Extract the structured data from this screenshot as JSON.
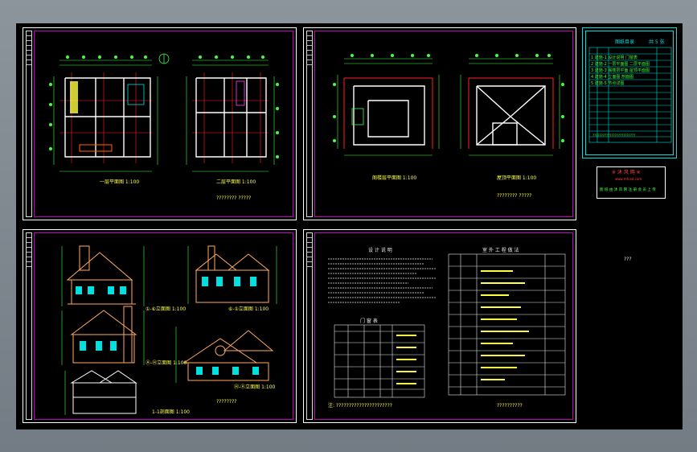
{
  "colors": {
    "background": "#000000",
    "frame_outer": "#ffffff",
    "frame_inner": "#c000c0",
    "dimension": "#40ff40",
    "wall": "#ffffff",
    "axis": "#ff2020",
    "title_text": "#ffff40",
    "index_table": "#00e0e0"
  },
  "sheets": {
    "plans_1": {
      "plan_a_title": "一层平面图 1:100",
      "plan_b_title": "二层平面图 1:100",
      "note": "???????? ?????"
    },
    "plans_2": {
      "plan_a_title": "阁楼层平面图 1:100",
      "plan_b_title": "屋顶平面图 1:100",
      "note": "???????? ?????"
    },
    "elevations": {
      "elev_a_title": "①-⑥立面图 1:100",
      "elev_b_title": "⑥-①立面图 1:100",
      "elev_c_title": "Ⓐ-Ⓗ立面图 1:100",
      "elev_d_title": "Ⓗ-Ⓐ立面图 1:100",
      "section_title": "1-1剖面图 1:100",
      "note": "????????"
    },
    "notes": {
      "heading_left": "设 计 说 明",
      "heading_right": "室 外 工 程 做 法",
      "door_table_title": "门 窗 表",
      "footer_note": "注: ??????????????????????",
      "sign": "??????????"
    }
  },
  "index_panel": {
    "title": "图纸目录",
    "subtitle": "共 5 张",
    "columns": [
      "序号",
      "图 号",
      "图 纸 名 称",
      "备注"
    ],
    "rows": [
      [
        "1",
        "建施-1",
        "设计说明 门窗表",
        ""
      ],
      [
        "2",
        "建施-2",
        "一层平面图 二层平面图",
        ""
      ],
      [
        "3",
        "建施-3",
        "阁楼层平面 屋顶平面图",
        ""
      ],
      [
        "4",
        "建施-4",
        "立面图 剖面图",
        ""
      ],
      [
        "5",
        "建施-5",
        "节点详图",
        ""
      ]
    ],
    "footer": "?????????????????????????"
  },
  "stamp_panel": {
    "title": "※ 沐 风 网 ※",
    "subtitle": "www.mfcad.com",
    "text": "图 纸 由 沐 风 网 注 册 会 员 上 传"
  },
  "loose_label": "???"
}
